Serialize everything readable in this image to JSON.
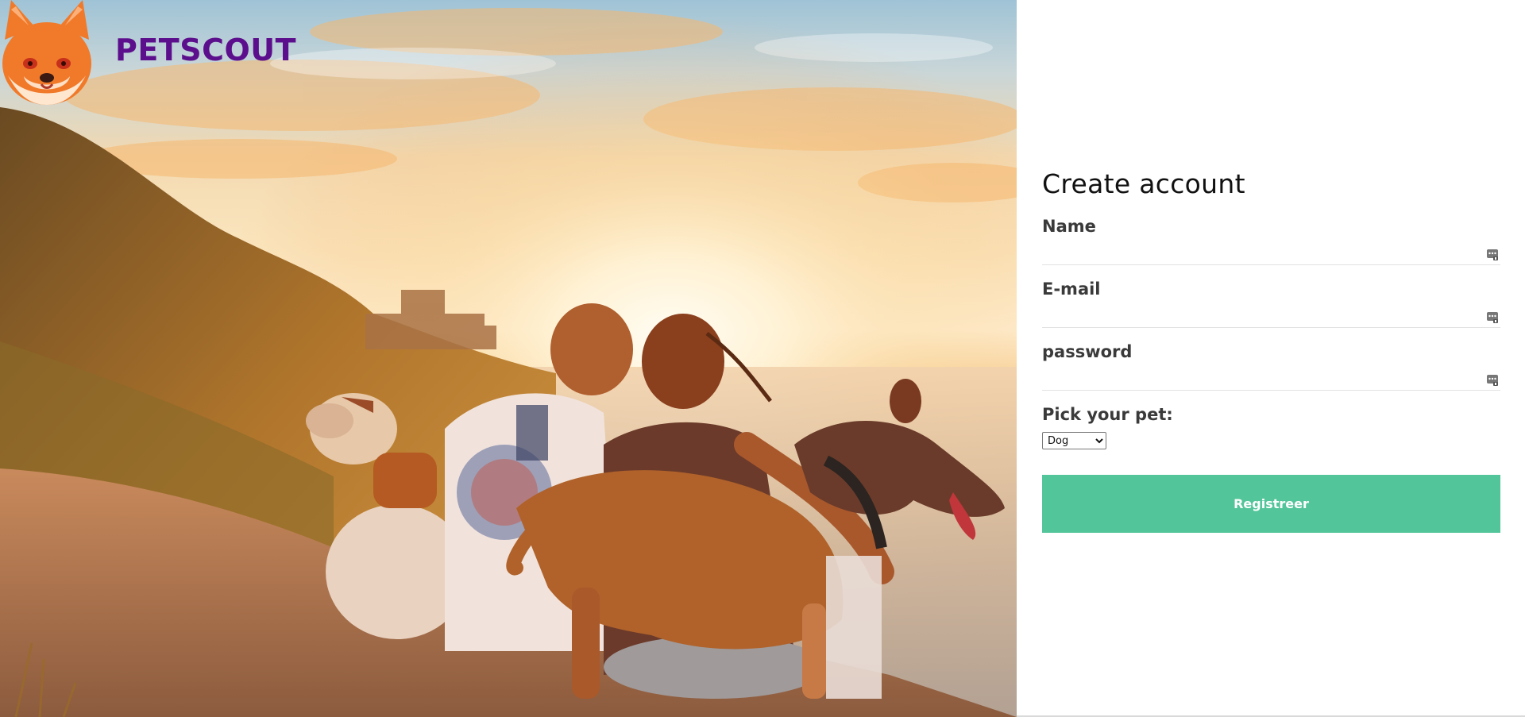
{
  "brand": {
    "name": "PETSCOUT",
    "logo_icon": "shiba-fox-face-icon",
    "name_color": "#5c0f8c"
  },
  "hero_image": {
    "description_icon": "sunset-people-with-dogs-photo"
  },
  "form": {
    "title": "Create account",
    "fields": [
      {
        "label": "Name",
        "value": "",
        "placeholder": "",
        "icon": "password-manager-autofill-icon"
      },
      {
        "label": "E-mail",
        "value": "",
        "placeholder": "",
        "icon": "password-manager-autofill-icon"
      },
      {
        "label": "password",
        "value": "",
        "placeholder": "",
        "icon": "password-manager-autofill-icon"
      }
    ],
    "pet_label": "Pick your pet:",
    "pet_selected": "Dog",
    "submit_label": "Registreer",
    "submit_color": "#52c59a"
  }
}
